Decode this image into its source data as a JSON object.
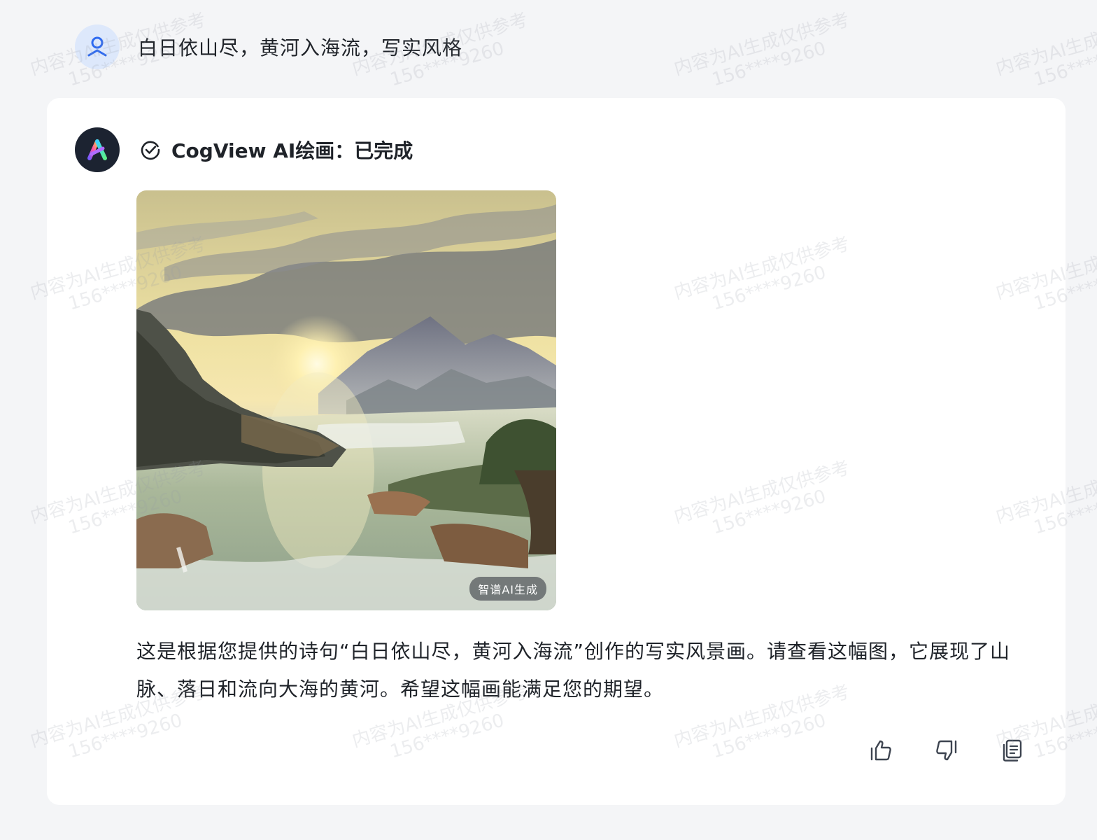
{
  "user_message": {
    "text": "白日依山尽，黄河入海流，写实风格",
    "avatar_icon": "user-icon"
  },
  "bot": {
    "avatar_icon": "zhipu-logo",
    "status_icon": "check-circle-icon",
    "status_text": "CogView AI绘画：已完成",
    "image_badge": "智谱AI生成",
    "answer_text": "这是根据您提供的诗句“白日依山尽，黄河入海流”创作的写实风景画。请查看这幅图，它展现了山脉、落日和流向大海的黄河。希望这幅画能满足您的期望。",
    "actions": [
      "thumbs-up-icon",
      "thumbs-down-icon",
      "copy-icon"
    ]
  },
  "watermark": {
    "line1": "内容为AI生成仅供参考",
    "line2": "156****9260"
  },
  "colors": {
    "page_bg": "#f4f5f7",
    "card_bg": "#ffffff",
    "accent": "#2f6bf0"
  }
}
